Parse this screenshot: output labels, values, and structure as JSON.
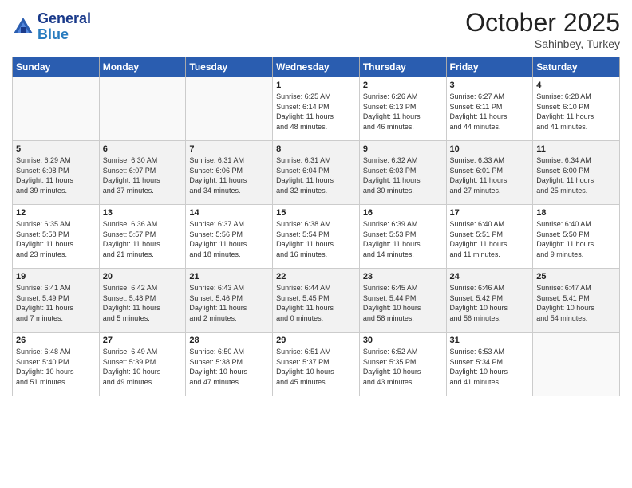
{
  "header": {
    "logo_line1": "General",
    "logo_line2": "Blue",
    "month": "October 2025",
    "location": "Sahinbey, Turkey"
  },
  "days_of_week": [
    "Sunday",
    "Monday",
    "Tuesday",
    "Wednesday",
    "Thursday",
    "Friday",
    "Saturday"
  ],
  "weeks": [
    [
      {
        "day": "",
        "info": ""
      },
      {
        "day": "",
        "info": ""
      },
      {
        "day": "",
        "info": ""
      },
      {
        "day": "1",
        "info": "Sunrise: 6:25 AM\nSunset: 6:14 PM\nDaylight: 11 hours\nand 48 minutes."
      },
      {
        "day": "2",
        "info": "Sunrise: 6:26 AM\nSunset: 6:13 PM\nDaylight: 11 hours\nand 46 minutes."
      },
      {
        "day": "3",
        "info": "Sunrise: 6:27 AM\nSunset: 6:11 PM\nDaylight: 11 hours\nand 44 minutes."
      },
      {
        "day": "4",
        "info": "Sunrise: 6:28 AM\nSunset: 6:10 PM\nDaylight: 11 hours\nand 41 minutes."
      }
    ],
    [
      {
        "day": "5",
        "info": "Sunrise: 6:29 AM\nSunset: 6:08 PM\nDaylight: 11 hours\nand 39 minutes."
      },
      {
        "day": "6",
        "info": "Sunrise: 6:30 AM\nSunset: 6:07 PM\nDaylight: 11 hours\nand 37 minutes."
      },
      {
        "day": "7",
        "info": "Sunrise: 6:31 AM\nSunset: 6:06 PM\nDaylight: 11 hours\nand 34 minutes."
      },
      {
        "day": "8",
        "info": "Sunrise: 6:31 AM\nSunset: 6:04 PM\nDaylight: 11 hours\nand 32 minutes."
      },
      {
        "day": "9",
        "info": "Sunrise: 6:32 AM\nSunset: 6:03 PM\nDaylight: 11 hours\nand 30 minutes."
      },
      {
        "day": "10",
        "info": "Sunrise: 6:33 AM\nSunset: 6:01 PM\nDaylight: 11 hours\nand 27 minutes."
      },
      {
        "day": "11",
        "info": "Sunrise: 6:34 AM\nSunset: 6:00 PM\nDaylight: 11 hours\nand 25 minutes."
      }
    ],
    [
      {
        "day": "12",
        "info": "Sunrise: 6:35 AM\nSunset: 5:58 PM\nDaylight: 11 hours\nand 23 minutes."
      },
      {
        "day": "13",
        "info": "Sunrise: 6:36 AM\nSunset: 5:57 PM\nDaylight: 11 hours\nand 21 minutes."
      },
      {
        "day": "14",
        "info": "Sunrise: 6:37 AM\nSunset: 5:56 PM\nDaylight: 11 hours\nand 18 minutes."
      },
      {
        "day": "15",
        "info": "Sunrise: 6:38 AM\nSunset: 5:54 PM\nDaylight: 11 hours\nand 16 minutes."
      },
      {
        "day": "16",
        "info": "Sunrise: 6:39 AM\nSunset: 5:53 PM\nDaylight: 11 hours\nand 14 minutes."
      },
      {
        "day": "17",
        "info": "Sunrise: 6:40 AM\nSunset: 5:51 PM\nDaylight: 11 hours\nand 11 minutes."
      },
      {
        "day": "18",
        "info": "Sunrise: 6:40 AM\nSunset: 5:50 PM\nDaylight: 11 hours\nand 9 minutes."
      }
    ],
    [
      {
        "day": "19",
        "info": "Sunrise: 6:41 AM\nSunset: 5:49 PM\nDaylight: 11 hours\nand 7 minutes."
      },
      {
        "day": "20",
        "info": "Sunrise: 6:42 AM\nSunset: 5:48 PM\nDaylight: 11 hours\nand 5 minutes."
      },
      {
        "day": "21",
        "info": "Sunrise: 6:43 AM\nSunset: 5:46 PM\nDaylight: 11 hours\nand 2 minutes."
      },
      {
        "day": "22",
        "info": "Sunrise: 6:44 AM\nSunset: 5:45 PM\nDaylight: 11 hours\nand 0 minutes."
      },
      {
        "day": "23",
        "info": "Sunrise: 6:45 AM\nSunset: 5:44 PM\nDaylight: 10 hours\nand 58 minutes."
      },
      {
        "day": "24",
        "info": "Sunrise: 6:46 AM\nSunset: 5:42 PM\nDaylight: 10 hours\nand 56 minutes."
      },
      {
        "day": "25",
        "info": "Sunrise: 6:47 AM\nSunset: 5:41 PM\nDaylight: 10 hours\nand 54 minutes."
      }
    ],
    [
      {
        "day": "26",
        "info": "Sunrise: 6:48 AM\nSunset: 5:40 PM\nDaylight: 10 hours\nand 51 minutes."
      },
      {
        "day": "27",
        "info": "Sunrise: 6:49 AM\nSunset: 5:39 PM\nDaylight: 10 hours\nand 49 minutes."
      },
      {
        "day": "28",
        "info": "Sunrise: 6:50 AM\nSunset: 5:38 PM\nDaylight: 10 hours\nand 47 minutes."
      },
      {
        "day": "29",
        "info": "Sunrise: 6:51 AM\nSunset: 5:37 PM\nDaylight: 10 hours\nand 45 minutes."
      },
      {
        "day": "30",
        "info": "Sunrise: 6:52 AM\nSunset: 5:35 PM\nDaylight: 10 hours\nand 43 minutes."
      },
      {
        "day": "31",
        "info": "Sunrise: 6:53 AM\nSunset: 5:34 PM\nDaylight: 10 hours\nand 41 minutes."
      },
      {
        "day": "",
        "info": ""
      }
    ]
  ]
}
